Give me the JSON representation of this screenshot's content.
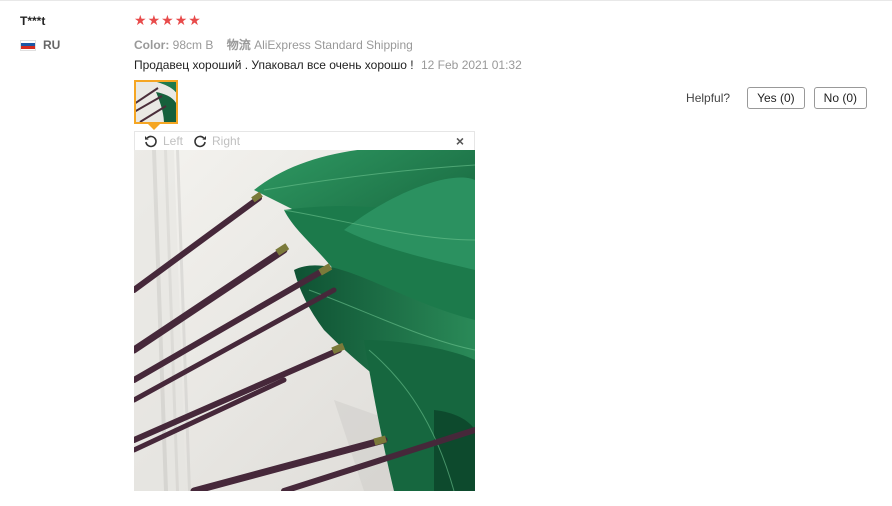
{
  "reviewer": {
    "name": "T***t",
    "country_code": "RU"
  },
  "rating": {
    "stars": 5,
    "color": "#e84b4b"
  },
  "attributes": [
    {
      "key": "Color:",
      "value": "98cm B"
    },
    {
      "key": "物流",
      "value": "AliExpress Standard Shipping"
    }
  ],
  "review": {
    "text": "Продавец хороший . Упаковал все очень хорошо !",
    "date": "12 Feb 2021 01:32"
  },
  "helpful": {
    "label": "Helpful?",
    "yes_label": "Yes (0)",
    "no_label": "No (0)"
  },
  "viewer": {
    "rotate_left_label": "Left",
    "rotate_right_label": "Right",
    "close_symbol": "×",
    "photo_icon": "leaves-photo"
  },
  "colors": {
    "thumb_border": "#f5a623",
    "leaf_green": "#1f7a4d"
  }
}
